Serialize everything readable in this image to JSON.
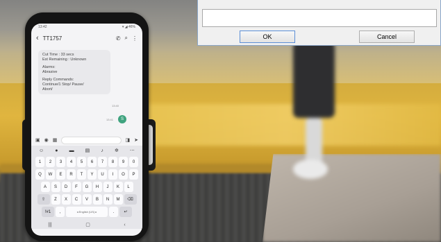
{
  "dialog": {
    "ok_label": "OK",
    "cancel_label": "Cancel"
  },
  "phone": {
    "status_time": "13:42",
    "status_icons": "▾ ◢ 46%",
    "contact_name": "TT1757",
    "message_lines_1": [
      "Cut Time : 33 secs",
      "Est Remaining : Unknown"
    ],
    "message_lines_2": [
      "Alarms:",
      "Abrasive"
    ],
    "message_lines_3": [
      "Reply Commands:",
      "Continue/1 Stop/ Pause/",
      "Abort/"
    ],
    "message_time": "13:40",
    "sent_time": "13:41",
    "avatar_letter": "S",
    "keyboard_rows": [
      [
        "1",
        "2",
        "3",
        "4",
        "5",
        "6",
        "7",
        "8",
        "9",
        "0"
      ],
      [
        "Q",
        "W",
        "E",
        "R",
        "T",
        "Y",
        "U",
        "I",
        "O",
        "P"
      ],
      [
        "A",
        "S",
        "D",
        "F",
        "G",
        "H",
        "J",
        "K",
        "L"
      ],
      [
        "Z",
        "X",
        "C",
        "V",
        "B",
        "N",
        "M"
      ]
    ],
    "space_label": "◂ English (US) ▸",
    "symbols_label": "!#1"
  }
}
